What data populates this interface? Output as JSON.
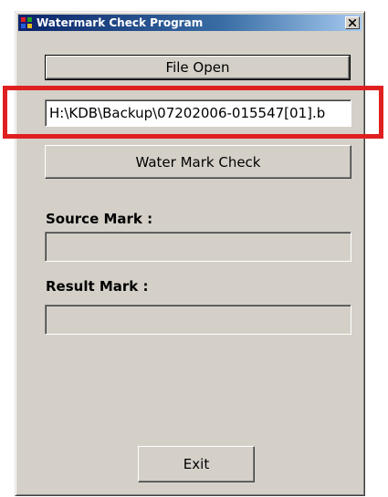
{
  "window": {
    "title": "Watermark Check Program",
    "app_icon": "application-icon",
    "close_icon": "close-icon"
  },
  "buttons": {
    "file_open": "File Open",
    "water_mark_check": "Water Mark Check",
    "exit": "Exit"
  },
  "file_path": {
    "value": "H:\\KDB\\Backup\\07202006-015547[01].b"
  },
  "labels": {
    "source_mark": "Source Mark :",
    "result_mark": "Result Mark :"
  },
  "fields": {
    "source_mark_value": "",
    "result_mark_value": ""
  },
  "colors": {
    "highlight": "#e02020",
    "titlebar": "#0a246a",
    "window_bg": "#d4d0c8"
  }
}
